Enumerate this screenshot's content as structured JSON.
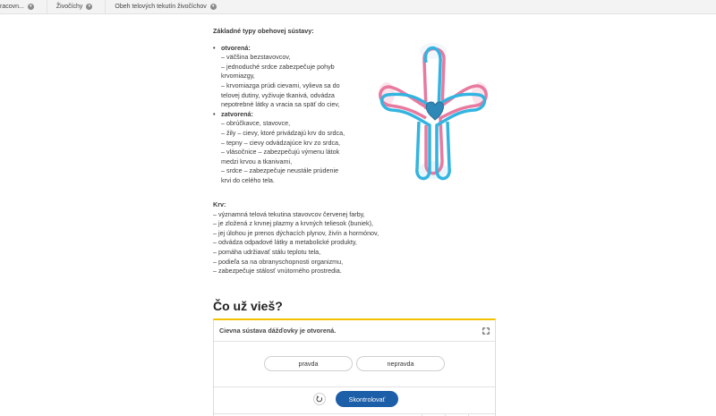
{
  "breadcrumb": {
    "items": [
      {
        "label": "racovn..."
      },
      {
        "label": "Živočíchy"
      },
      {
        "label": "Obeh telových tekutín živočíchov"
      }
    ]
  },
  "circulation": {
    "heading": "Základné typy obehovej sústavy:",
    "types": [
      {
        "title": "otvorená:",
        "lines": [
          "– väčšina bezstavovcov,",
          "– jednoduché srdce zabezpečuje pohyb",
          "krvomiazgy,",
          "– krvomiazga prúdi cievami, vylieva sa do",
          "telovej dutiny, vyživuje tkanivá, odvádza",
          "nepotrebné látky a vracia sa späť do ciev,"
        ]
      },
      {
        "title": "zatvorená:",
        "lines": [
          "– obrúčkavce, stavovce,",
          "– žily – cievy, ktoré privádzajú krv do srdca,",
          "– tepny – cievy odvádzajúce krv zo srdca,",
          "– vlásočnice – zabezpečujú výmenu látok",
          "medzi krvou a tkanivami,",
          "– srdce – zabezpečuje neustále prúdenie",
          "krvi do celého tela."
        ]
      }
    ]
  },
  "blood": {
    "title": "Krv:",
    "lines": [
      "– významná telová tekutina stavovcov červenej farby,",
      "– je zložená z krvnej plazmy a krvných teliesok (buniek),",
      "– jej úlohou je prenos dýchacích plynov, živín a hormónov,",
      "– odvádza odpadové látky a metabolické produkty,",
      "– pomáha udržiavať stálu teplotu tela,",
      "– podieľa sa na obranyschopnosti organizmu,",
      "– zabezpečuje stálosť vnútorného prostredia."
    ]
  },
  "quiz": {
    "title": "Čo už vieš?",
    "question": "Cievna sústava dážďovky je otvorená.",
    "answers": [
      "pravda",
      "nepravda"
    ],
    "check_label": "Skontrolovať"
  },
  "colors": {
    "accent": "#f2c200",
    "primary_button": "#1d5ea8",
    "vessel_blue": "#33b4e0",
    "vessel_pink": "#e8799f"
  },
  "icons": {
    "breadcrumb_chevron": "chevron-down-icon",
    "expand": "expand-icon",
    "reset": "reset-icon"
  }
}
